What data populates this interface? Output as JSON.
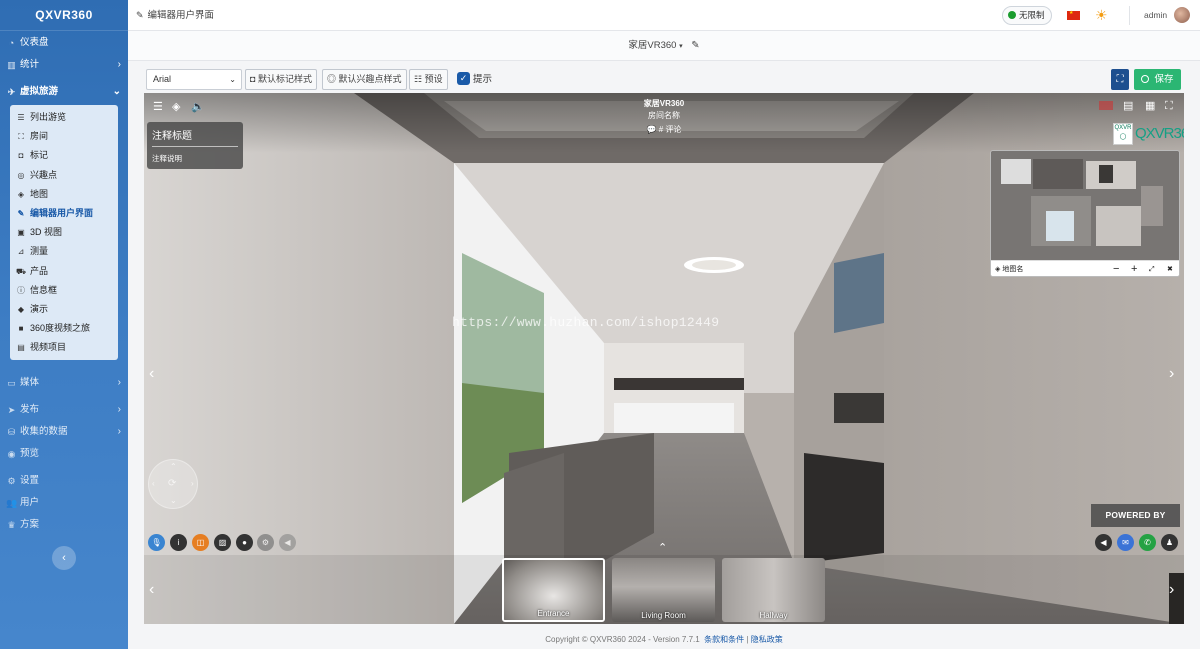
{
  "app": {
    "brand": "QXVR360"
  },
  "sidebar": {
    "items": [
      {
        "label": "仪表盘",
        "icon": "dashboard-icon"
      },
      {
        "label": "统计",
        "icon": "stats-icon"
      },
      {
        "label": "虚拟旅游",
        "icon": "route-icon"
      }
    ],
    "submenu": [
      {
        "label": "列出游览",
        "icon": "list-icon"
      },
      {
        "label": "房间",
        "icon": "room-icon"
      },
      {
        "label": "标记",
        "icon": "marker-icon"
      },
      {
        "label": "兴趣点",
        "icon": "poi-icon"
      },
      {
        "label": "地图",
        "icon": "map-icon"
      },
      {
        "label": "编辑器用户界面",
        "icon": "palette-icon"
      },
      {
        "label": "3D 视图",
        "icon": "cube-icon"
      },
      {
        "label": "测量",
        "icon": "ruler-icon"
      },
      {
        "label": "产品",
        "icon": "cart-icon"
      },
      {
        "label": "信息框",
        "icon": "info-icon"
      },
      {
        "label": "演示",
        "icon": "presentation-icon"
      },
      {
        "label": "360度视频之旅",
        "icon": "video-icon"
      },
      {
        "label": "视频项目",
        "icon": "film-icon"
      }
    ],
    "items2": [
      {
        "label": "媒体",
        "icon": "media-icon"
      },
      {
        "label": "发布",
        "icon": "publish-icon"
      },
      {
        "label": "收集的数据",
        "icon": "database-icon"
      },
      {
        "label": "预览",
        "icon": "eye-icon"
      },
      {
        "label": "设置",
        "icon": "cog-icon"
      },
      {
        "label": "用户",
        "icon": "users-icon"
      },
      {
        "label": "方案",
        "icon": "crown-icon"
      }
    ],
    "collapse_glyph": "‹"
  },
  "topbar": {
    "page_title": "编辑器用户界面",
    "limit_label": "无限制",
    "user": "admin"
  },
  "titlebar": {
    "tour_name": "家居VR360"
  },
  "toolbar": {
    "font": "Arial",
    "btn_marker_style": "默认标记样式",
    "btn_poi_style": "默认兴趣点样式",
    "btn_preset": "预设",
    "hint_label": "提示",
    "save_label": "保存"
  },
  "viewer": {
    "tour_title": "家居VR360",
    "room_name": "房间名称",
    "comments": "# 评论",
    "note_title": "注释标题",
    "note_desc": "注释说明",
    "logo_small": "QXVR",
    "logo_text": "QXVR360",
    "map_name": "地图名",
    "powered_by": "POWERED BY",
    "watermark": "https://www.huzhan.com/ishop12449",
    "thumbnails": [
      {
        "label": "Entrance"
      },
      {
        "label": "Living Room"
      },
      {
        "label": "Hallway"
      }
    ]
  },
  "footer": {
    "copyright": "Copyright © QXVR360 2024 - Version 7.7.1",
    "terms": "条款和条件",
    "sep": "|",
    "privacy": "隐私政策"
  },
  "colors": {
    "sidebar": "#3d7dc4",
    "save": "#2bb673",
    "primary": "#1a5aa8"
  }
}
